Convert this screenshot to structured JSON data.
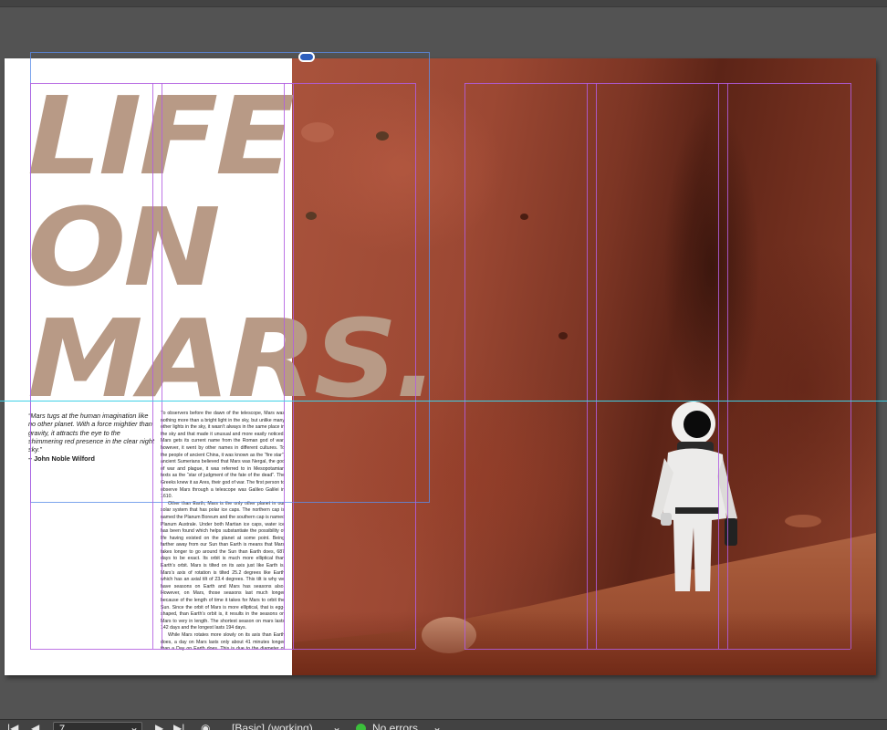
{
  "document": {
    "title_lines": [
      "LIFE",
      "ON",
      "MARS."
    ],
    "quote": "“Mars tugs at the human imagination like no other planet. With a force mightier than gravity, it attracts the eye to the shimmering red presence in the clear night sky.”",
    "quote_author": "– John Noble Wilford",
    "body_paragraphs": [
      "To observers before the dawn of the telescope, Mars was nothing more than a bright light in the sky, but unlike many other lights in the sky, it wasn’t always in the same place in the sky and that made it unusual and more easily noticed. Mars gets its current name from the Roman god of war, however, it went by other names in different cultures. To the people of ancient China, it was known as the “fire star”, ancient Sumerians believed that Mars was Nergal, the god of war and plague, it was referred to in Mesopotamian texts as the “star of judgment of the fate of the dead”. The Greeks knew it as Ares, their god of war. The first person to observe Mars through a telescope was Galileo Galilei in 1610.",
      "Other than Earth, Mars is the only other planet in our solar system that has polar ice caps. The northern cap is named the Planum Boreum and the southern cap is named Planum Australe. Under both Martian ice caps, water ice has been found which helps substantiate the possibility of life having existed on the planet at some point. Being farther away from our Sun than Earth is means that Mars takes longer to go around the Sun than Earth does, 687 days to be exact. Its orbit is much more elliptical than Earth’s orbit. Mars is tilted on its axis just like Earth is. Mars’s axis of rotation is tilted 25.2 degrees like Earth which has an axial tilt of 23.4 degrees. This tilt is why we have seasons on Earth and Mars has seasons also. However, on Mars, those seasons last much longer because of the length of time it takes for Mars to orbit the Sun. Since the orbit of Mars is more elliptical, that is egg-shaped, than Earth’s orbit is, it results in the seasons on Mars to very in length. The shortest season on mars lasts 142 days and the longest lasts 194 days.",
      "While Mars rotates more slowly on its axis than Earth does, a day on Mars lasts only about 41 minutes longer than a Day on Earth does. This is due to the diameter of Mars being about 3,700 miles less than the diameter of Earth."
    ]
  },
  "statusbar": {
    "page_number": "7",
    "preflight_profile": "[Basic] (working)",
    "preflight_status": "No errors"
  },
  "colors": {
    "title": "#b89a86",
    "guide": "#b25de0",
    "frame": "#5b8de8",
    "cyan_guide": "#3fd0e6",
    "pasteboard": "#535353"
  }
}
